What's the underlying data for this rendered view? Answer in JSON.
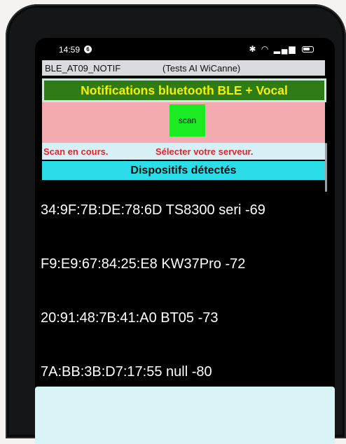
{
  "status_bar": {
    "time": "14:59",
    "notification_badge": "6",
    "icons": [
      "bluetooth-icon",
      "wifi-icon",
      "signal-icon",
      "battery-icon"
    ]
  },
  "app": {
    "title": "BLE_AT09_NOTIF",
    "subtitle": "(Tests AI WiCanne)"
  },
  "banner": {
    "text": "Notifications bluetooth BLE + Vocal",
    "bg": "#2f7b16",
    "fg": "#f5f100"
  },
  "scan": {
    "button_label": "scan",
    "button_color": "#1aeb23",
    "area_color": "#f3aab0"
  },
  "status": {
    "left": "Scan en cours.",
    "right": "Sélecter votre serveur.",
    "color": "#e8202a"
  },
  "devices": {
    "header": "Dispositifs détectés",
    "items": [
      {
        "label": "34:9F:7B:DE:78:6D TS8300 seri -69"
      },
      {
        "label": "F9:E9:67:84:25:E8 KW37Pro -72"
      },
      {
        "label": "20:91:48:7B:41:A0 BT05 -73"
      },
      {
        "label": "7A:BB:3B:D7:17:55 null -80"
      }
    ]
  }
}
